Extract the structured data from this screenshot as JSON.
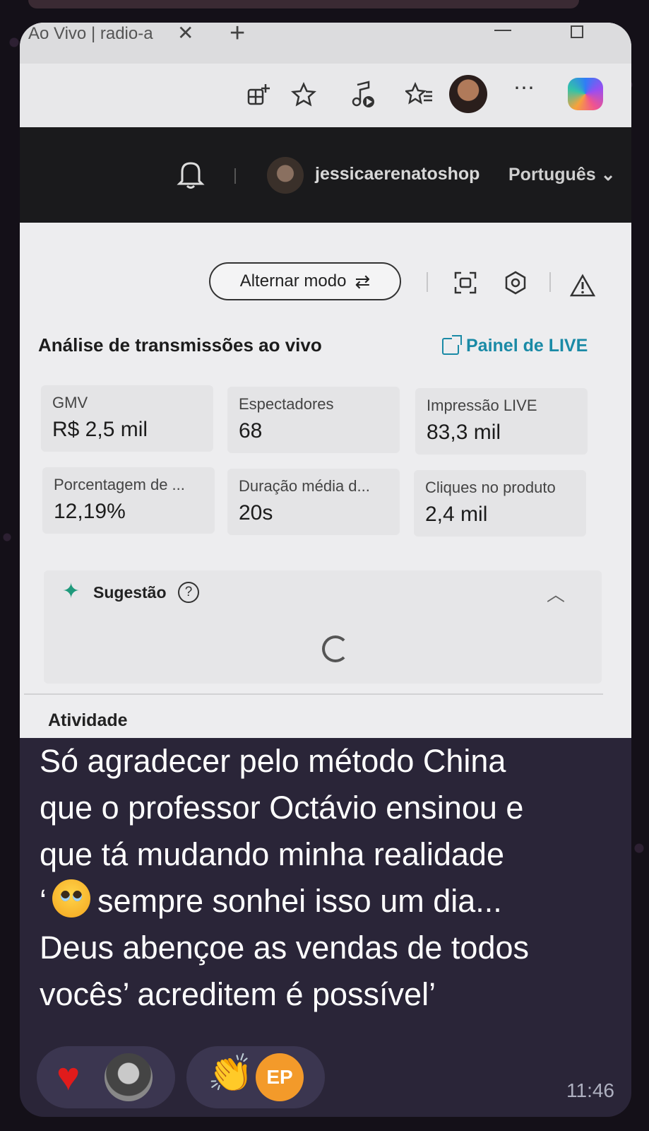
{
  "browser": {
    "tab_title": "Ao Vivo | radio-a",
    "close_glyph": "✕",
    "new_tab_glyph": "+"
  },
  "site_header": {
    "shop_name": "jessicaerenatoshop",
    "language": "Português ⌄"
  },
  "controls": {
    "toggle_mode": "Alternar modo",
    "toggle_icon": "⇄"
  },
  "analysis": {
    "title": "Análise de transmissões ao vivo",
    "live_panel_link": "Painel de LIVE",
    "metrics": [
      {
        "label": "GMV",
        "value": "R$ 2,5 mil"
      },
      {
        "label": "Espectadores",
        "value": "68"
      },
      {
        "label": "Impressão LIVE",
        "value": "83,3 mil"
      },
      {
        "label": "Porcentagem de ...",
        "value": "12,19%"
      },
      {
        "label": "Duração média d...",
        "value": "20s"
      },
      {
        "label": "Cliques no produto",
        "value": "2,4 mil"
      }
    ],
    "suggestion_label": "Sugestão",
    "help_glyph": "?",
    "activity_label": "Atividade"
  },
  "message": {
    "lines": [
      "Só agradecer pelo método China",
      "que o professor Octávio ensinou e",
      "que tá mudando minha realidade",
      "sempre sonhei isso um dia...",
      "Deus abençoe as vendas de todos",
      "vocês’ acreditem é possível’"
    ],
    "line4_prefix": "‘",
    "timestamp": "11:46"
  },
  "reactions": [
    {
      "emoji": "heart",
      "glyph": "♥"
    },
    {
      "emoji": "clap",
      "glyph": "👏",
      "initials": "EP"
    }
  ],
  "colors": {
    "bubble": "#2a2538",
    "accent_link": "#1a8aa6",
    "sparkle": "#1f9a7c",
    "ep_avatar": "#f39a2a",
    "heart": "#e11b1b"
  }
}
